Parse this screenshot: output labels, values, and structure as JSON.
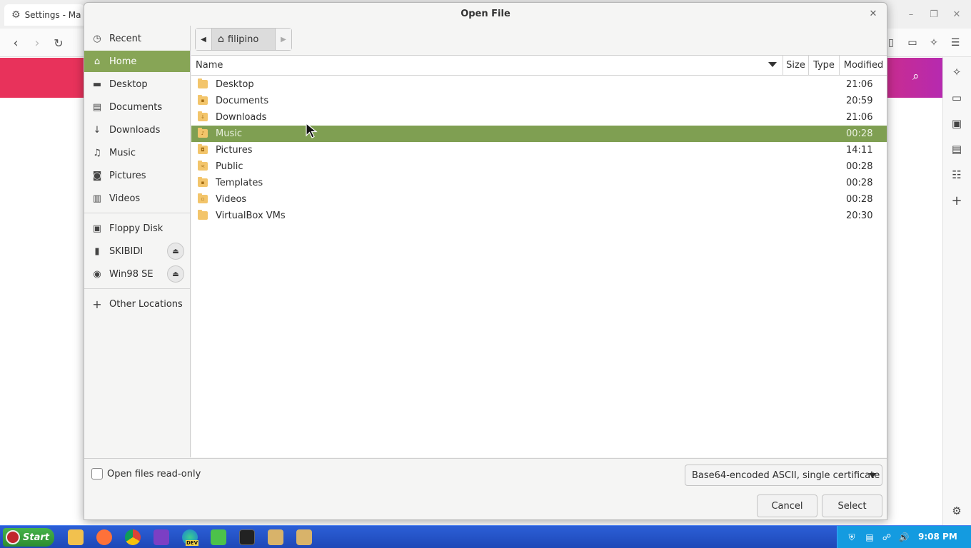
{
  "browser": {
    "tab_title": "Settings - Ma",
    "sidebar_icons": [
      "sparkle-icon",
      "video-icon",
      "wallet-icon",
      "save-icon",
      "reader-icon",
      "plus-icon",
      "settings-icon"
    ]
  },
  "dialog": {
    "title": "Open File",
    "path_crumb": "filipino",
    "places": [
      {
        "label": "Recent",
        "icon": "clock-icon"
      },
      {
        "label": "Home",
        "icon": "home-icon",
        "selected": true
      },
      {
        "label": "Desktop",
        "icon": "desktop-icon"
      },
      {
        "label": "Documents",
        "icon": "documents-icon"
      },
      {
        "label": "Downloads",
        "icon": "download-icon"
      },
      {
        "label": "Music",
        "icon": "music-icon"
      },
      {
        "label": "Pictures",
        "icon": "camera-icon"
      },
      {
        "label": "Videos",
        "icon": "video-icon"
      }
    ],
    "devices": [
      {
        "label": "Floppy Disk",
        "icon": "floppy-icon"
      },
      {
        "label": "SKIBIDI",
        "icon": "usb-icon",
        "eject": true
      },
      {
        "label": "Win98 SE",
        "icon": "disc-icon",
        "eject": true
      }
    ],
    "other_locations": "Other Locations",
    "columns": {
      "name": "Name",
      "size": "Size",
      "type": "Type",
      "modified": "Modified"
    },
    "files": [
      {
        "name": "Desktop",
        "modified": "21:06"
      },
      {
        "name": "Documents",
        "modified": "20:59"
      },
      {
        "name": "Downloads",
        "modified": "21:06"
      },
      {
        "name": "Music",
        "modified": "00:28",
        "selected": true
      },
      {
        "name": "Pictures",
        "modified": "14:11"
      },
      {
        "name": "Public",
        "modified": "00:28"
      },
      {
        "name": "Templates",
        "modified": "00:28"
      },
      {
        "name": "Videos",
        "modified": "00:28"
      },
      {
        "name": "VirtualBox VMs",
        "modified": "20:30"
      }
    ],
    "readonly_label": "Open files read-only",
    "filter_value": "Base64-encoded ASCII, single certificate",
    "cancel_label": "Cancel",
    "select_label": "Select"
  },
  "taskbar": {
    "start_label": "Start",
    "dev_badge": "DEV",
    "clock": "9:08 PM"
  },
  "colors": {
    "selection": "#87a556",
    "taskbar": "#1e48b8",
    "start": "#2c8d30",
    "tray": "#149be0"
  }
}
